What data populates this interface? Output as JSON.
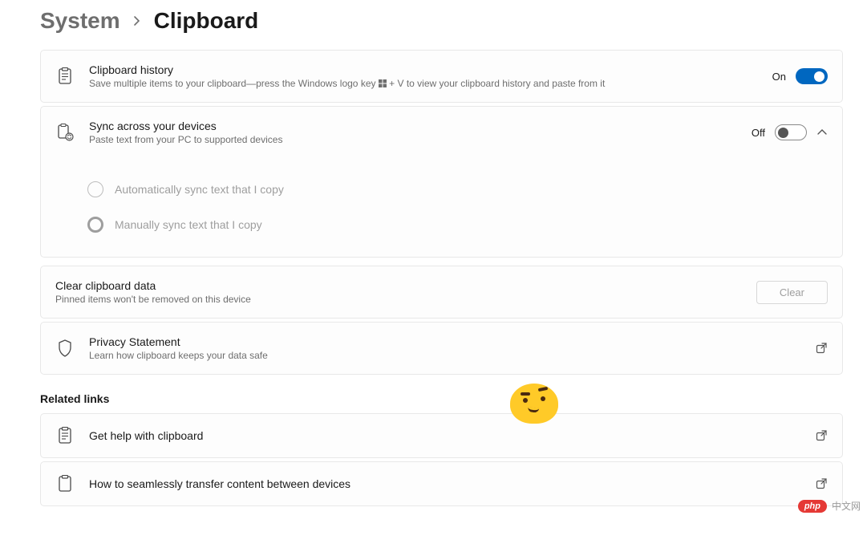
{
  "breadcrumb": {
    "parent": "System",
    "current": "Clipboard"
  },
  "cards": {
    "history": {
      "title": "Clipboard history",
      "desc_prefix": "Save multiple items to your clipboard—press the Windows logo key ",
      "desc_suffix": " + V to view your clipboard history and paste from it",
      "state_label": "On",
      "toggle_on": true
    },
    "sync": {
      "title": "Sync across your devices",
      "desc": "Paste text from your PC to supported devices",
      "state_label": "Off",
      "toggle_on": false,
      "expanded": true,
      "options": [
        {
          "label": "Automatically sync text that I copy",
          "selected": false
        },
        {
          "label": "Manually sync text that I copy",
          "selected": true
        }
      ]
    },
    "clear": {
      "title": "Clear clipboard data",
      "desc": "Pinned items won't be removed on this device",
      "button_label": "Clear"
    },
    "privacy": {
      "title": "Privacy Statement",
      "desc": "Learn how clipboard keeps your data safe"
    }
  },
  "related": {
    "heading": "Related links",
    "links": [
      {
        "label": "Get help with clipboard"
      },
      {
        "label": "How to seamlessly transfer content between devices"
      }
    ]
  },
  "watermark": {
    "badge": "php",
    "text": "中文网"
  }
}
